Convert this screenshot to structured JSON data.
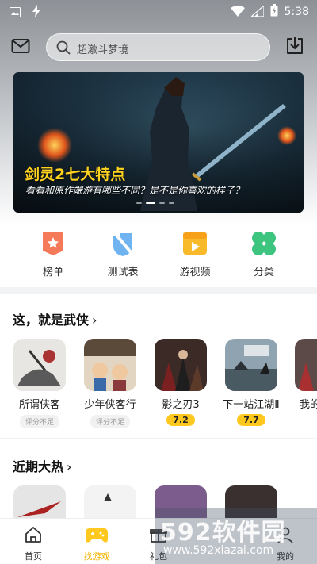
{
  "status_bar": {
    "time": "5:38"
  },
  "search": {
    "placeholder": "超激斗梦境"
  },
  "banner": {
    "title": "剑灵2七大特点",
    "subtitle": "看看和原作端游有哪些不同？是不是你喜欢的样子？"
  },
  "quick_menu": [
    {
      "label": "榜单",
      "icon": "ranking-icon"
    },
    {
      "label": "测试表",
      "icon": "test-table-icon"
    },
    {
      "label": "游视频",
      "icon": "video-icon"
    },
    {
      "label": "分类",
      "icon": "category-icon"
    }
  ],
  "sections": [
    {
      "title": "这，就是武侠",
      "games": [
        {
          "name": "所谓侠客",
          "rating": "评分不足"
        },
        {
          "name": "少年侠客行",
          "rating": "评分不足"
        },
        {
          "name": "影之刃3",
          "rating": "7.2"
        },
        {
          "name": "下一站江湖Ⅱ",
          "rating": "7.7"
        },
        {
          "name": "我的",
          "rating": ""
        }
      ]
    },
    {
      "title": "近期大热"
    }
  ],
  "bottom_nav": [
    {
      "label": "首页"
    },
    {
      "label": "找游戏"
    },
    {
      "label": "礼包"
    },
    {
      "label": "我的"
    }
  ],
  "watermark": {
    "brand": "592软件园",
    "url": "www.592xiazai.com"
  },
  "colors": {
    "accent": "#ffc81e",
    "banner_title": "#ffd21f",
    "active_nav": "#f5b400"
  }
}
